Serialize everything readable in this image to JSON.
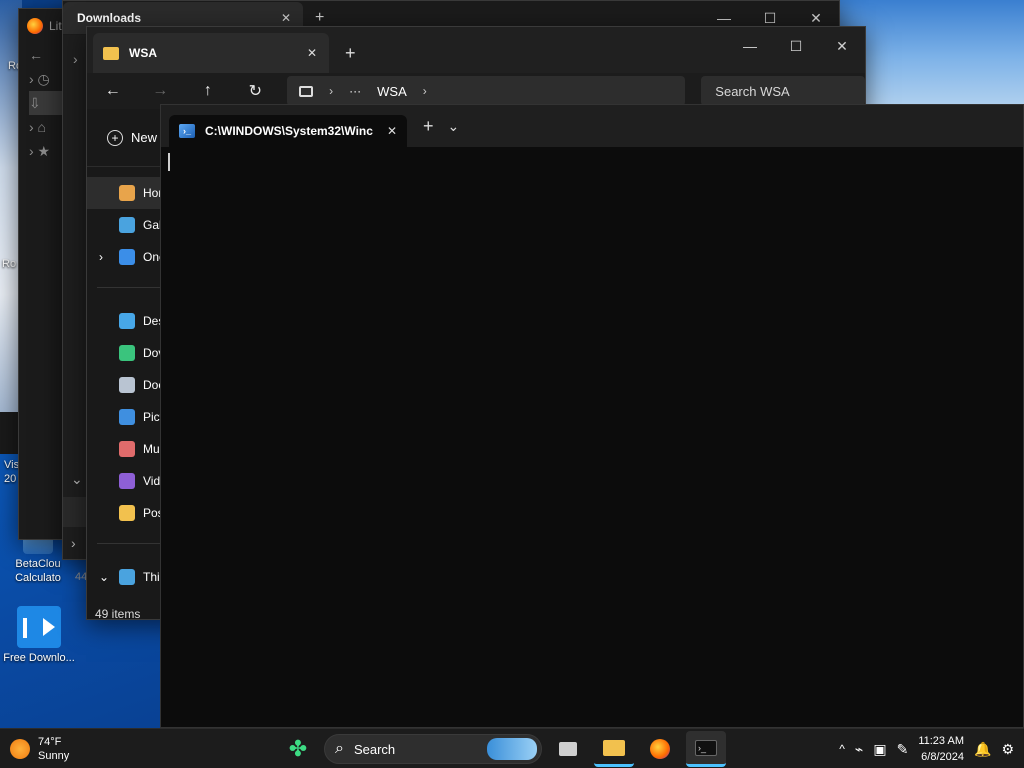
{
  "desktop": {
    "icons": [
      {
        "label": "BetaClou Calculato"
      },
      {
        "label": "Free Downlo..."
      }
    ],
    "partial_labels": {
      "top": "Ro",
      "mid": "Ro",
      "vis": "Vis 20"
    }
  },
  "firefox_window": {
    "title": "Lit",
    "count": "44"
  },
  "downloads_window": {
    "tab_title": "Downloads"
  },
  "explorer": {
    "tab_title": "WSA",
    "new_tab_label": "+",
    "breadcrumb": {
      "more": "···",
      "folder": "WSA"
    },
    "search_placeholder": "Search WSA",
    "new_button": "New",
    "sidebar": [
      {
        "label": "Hor",
        "icon": "home-icon"
      },
      {
        "label": "Gall",
        "icon": "gallery-icon"
      },
      {
        "label": "One",
        "icon": "onedrive-icon"
      },
      {
        "label": "Des",
        "icon": "desktop-folder-icon"
      },
      {
        "label": "Dov",
        "icon": "downloads-folder-icon"
      },
      {
        "label": "Doc",
        "icon": "documents-folder-icon"
      },
      {
        "label": "Pict",
        "icon": "pictures-folder-icon"
      },
      {
        "label": "Mu",
        "icon": "music-folder-icon"
      },
      {
        "label": "Vide",
        "icon": "videos-folder-icon"
      },
      {
        "label": "Pos",
        "icon": "folder-icon"
      },
      {
        "label": "This",
        "icon": "this-pc-icon"
      }
    ],
    "status": "49 items"
  },
  "terminal": {
    "tab_title": "C:\\WINDOWS\\System32\\Winc",
    "new_tab": "+",
    "dropdown": "⌄"
  },
  "taskbar": {
    "weather_temp": "74°F",
    "weather_desc": "Sunny",
    "search_label": "Search",
    "time": "11:23 AM",
    "date": "6/8/2024"
  },
  "colors": {
    "accent": "#4cc2ff",
    "folder": "#f2c14e",
    "terminal_bg": "#0c0c0c"
  }
}
